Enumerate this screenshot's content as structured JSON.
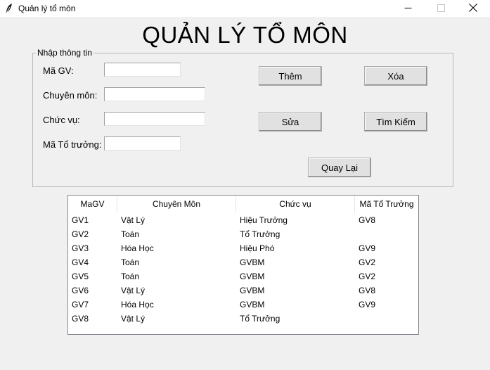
{
  "window": {
    "title": "Quản lý tổ môn",
    "minimize_glyph": "—",
    "close_glyph": "✕"
  },
  "heading": "QUẢN LÝ TỔ MÔN",
  "form": {
    "group_title": "Nhập thông tin",
    "labels": {
      "ma_gv": "Mã GV:",
      "chuyen_mon": "Chuyên môn:",
      "chuc_vu": "Chức vụ:",
      "ma_to_truong": "Mã Tổ trưởng:"
    },
    "values": {
      "ma_gv": "",
      "chuyen_mon": "",
      "chuc_vu": "",
      "ma_to_truong": ""
    }
  },
  "buttons": {
    "them": "Thêm",
    "xoa": "Xóa",
    "sua": "Sửa",
    "tim_kiem": "Tìm Kiếm",
    "quay_lai": "Quay Lại"
  },
  "table": {
    "columns": [
      "MaGV",
      "Chuyên Môn",
      "Chức vụ",
      "Mã Tổ Trưởng"
    ],
    "rows": [
      [
        "GV1",
        "Vật Lý",
        "Hiệu Trưởng",
        "GV8"
      ],
      [
        "GV2",
        "Toán",
        "Tổ Trưởng",
        ""
      ],
      [
        "GV3",
        "Hóa Học",
        "Hiệu Phó",
        "GV9"
      ],
      [
        "GV4",
        "Toán",
        "GVBM",
        "GV2"
      ],
      [
        "GV5",
        "Toán",
        "GVBM",
        "GV2"
      ],
      [
        "GV6",
        "Vật Lý",
        "GVBM",
        "GV8"
      ],
      [
        "GV7",
        "Hóa Học",
        "GVBM",
        "GV9"
      ],
      [
        "GV8",
        "Vật Lý",
        "Tổ Trưởng",
        ""
      ]
    ]
  },
  "icons": {
    "app": "feather-icon",
    "minimize": "minimize-icon",
    "maximize": "maximize-icon",
    "close": "close-icon"
  }
}
